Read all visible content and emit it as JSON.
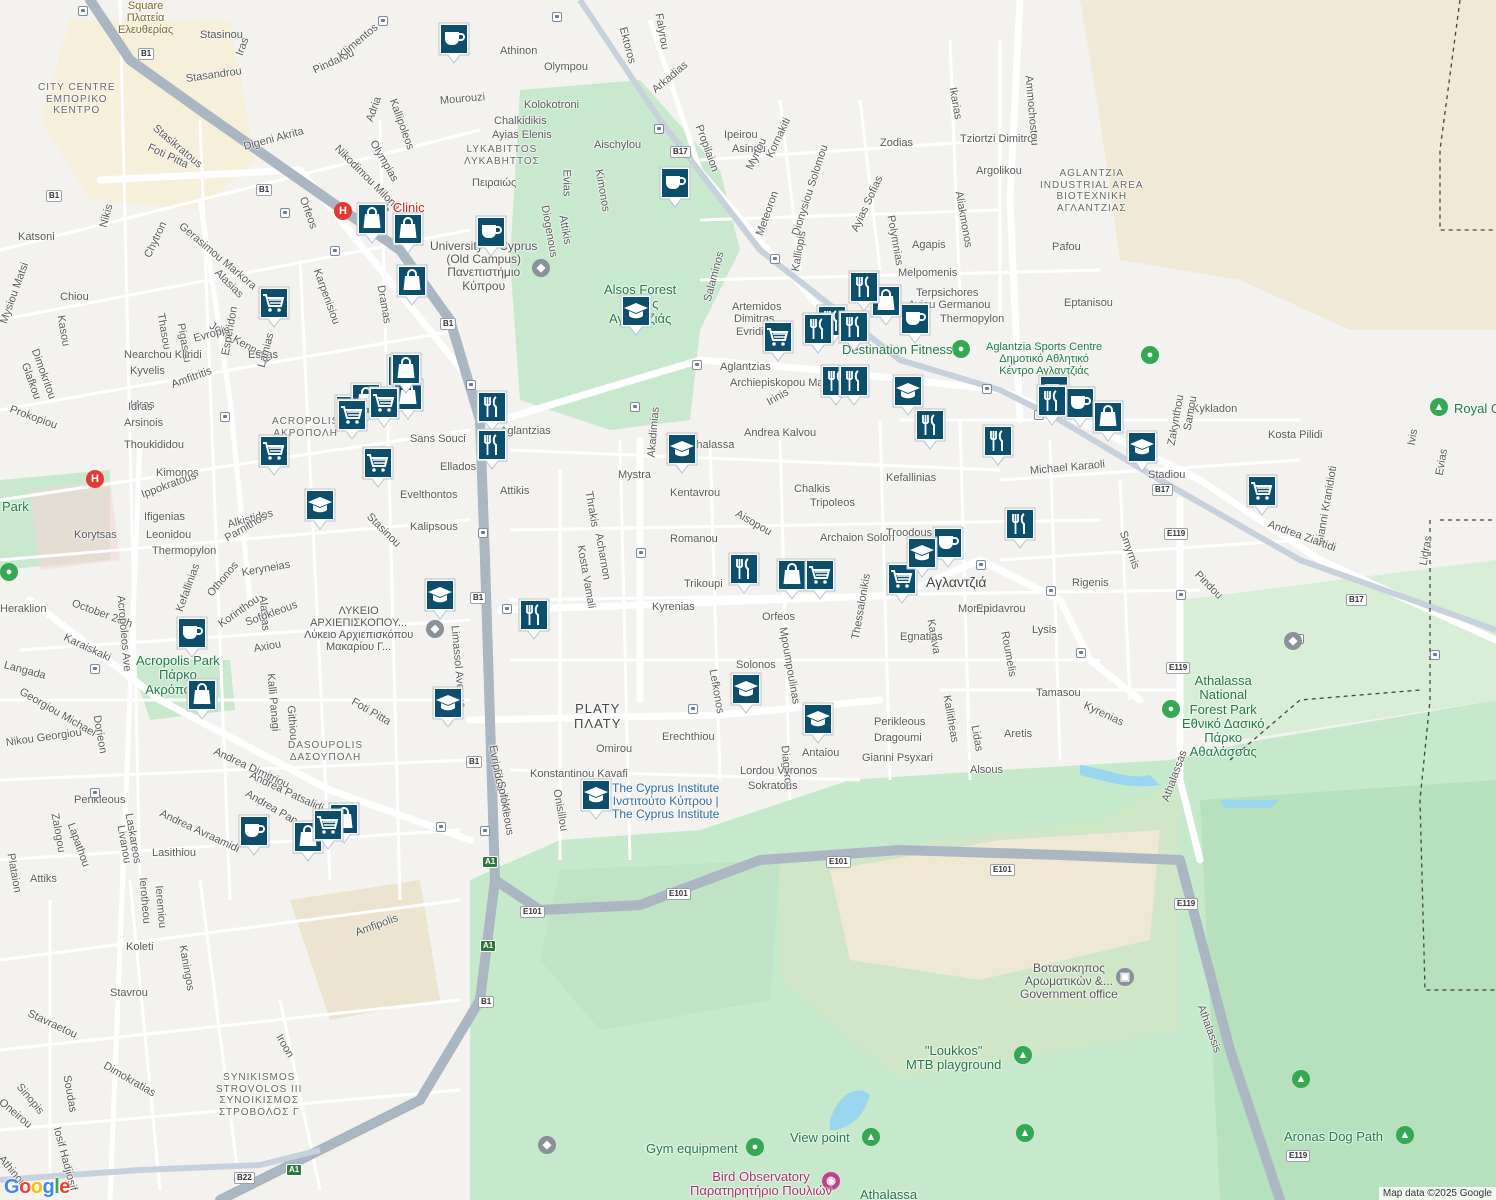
{
  "map": {
    "attribution": "Map data ©2025 Google",
    "logo_text": "Google",
    "colors": {
      "background": "#f3f2ef",
      "park": "#c9e9cf",
      "forest": "#bfe3c4",
      "road": "#ffffff",
      "highway": "#b8c3cf",
      "water": "#9ad6f0",
      "pin": "#0b4f6c",
      "boundary": "#444444"
    }
  },
  "street_labels": [
    "Stasinou",
    "Pindarou",
    "Stasandrou",
    "Iras",
    "Klimentos",
    "Kallipoleos",
    "Athinon",
    "Olympou",
    "Ektoros",
    "Falyrou",
    "Mourouzi",
    "Arkadias",
    "Kolokotroni",
    "Chalkidikis",
    "Ayias Elenis",
    "Aischylou",
    "Ipeirou",
    "Asinou",
    "Propilaion",
    "Stasikratous",
    "Foti Pitta",
    "Digeni Akrita",
    "Olympias",
    "Nikodimou Milona",
    "Adria",
    "Zodias",
    "Tziortzi Dimitrof",
    "Argolikou",
    "Myrtou",
    "Kornakiti",
    "Ikarias",
    "Ammochostou",
    "Evias",
    "Kimonos",
    "Πειραιώς",
    "Diogenous",
    "Attikis",
    "Meteoron",
    "Dionysiou Solomou",
    "Ayias Sofias",
    "Polymnias",
    "Agapis",
    "Aliakmonos",
    "Pafou",
    "Gerasimou Markora",
    "Orfeos",
    "Katsoni",
    "Nikis",
    "Chytron",
    "Alasias",
    "Karpenisiou",
    "Dramas",
    "Chiou",
    "Thasou",
    "Pigasou",
    "John Kennedy",
    "Estias",
    "Esperidon",
    "Nearchou Kliridi",
    "Kyvelis",
    "Amfitritis",
    "Lamias",
    "Evropis",
    "Kalliopis",
    "Artemidos",
    "Dimitras",
    "Evridikis",
    "Melpomenis",
    "Terpsichores",
    "Ayiou Germanou",
    "Thermopylon",
    "Eptanisou",
    "Salaminos",
    "Aglantzias",
    "Archiepiskopou Makariou III",
    "Irinis",
    "Andrea Kalvou",
    "Idras",
    "Arsinois",
    "Thoukididou",
    "Kimonos",
    "Ippokratous",
    "Ifigenias",
    "Sans Souci",
    "Ellados",
    "Attikis",
    "Mystra",
    "Akadimias",
    "Kentavrou",
    "Chalkis",
    "Tripoleos",
    "Kefallinias",
    "Michael Karaoli",
    "Stadiou",
    "Kykladon",
    "Kosta Pilidi",
    "Evelthontos",
    "Thrakis",
    "Acharnon",
    "Kosta Vamali",
    "Aisopou",
    "Romanou",
    "Archaion Solon",
    "Troodous",
    "Kalipsous",
    "Alkistidos",
    "Parnithos",
    "Leonidou",
    "Thermopylon",
    "Korytsas",
    "Evripidou",
    "Stasinou",
    "Smyrnis",
    "Pindou",
    "Gianni Kranidioti",
    "Lidras",
    "Andrea Ziartidi",
    "Zakynthou",
    "Samou",
    "Ivis",
    "Trikoupi",
    "Kyrenias",
    "Orfeos",
    "Mpoumpoulinas",
    "Karava",
    "Morfou",
    "Epidavrou",
    "Roumelis",
    "Rigenis",
    "Lysis",
    "Egnatias",
    "Heraklion",
    "October 28th",
    "Kefallinias",
    "Othonos",
    "Korinthou",
    "Keryneias",
    "Alasias",
    "Karaiskaki",
    "Sofokleous",
    "Axiou",
    "Kalli Panagi",
    "Githiou",
    "Foti Pitta",
    "Langada",
    "Georgiou Michael",
    "Nikou Georgiou",
    "Thessalonikis",
    "Solonos",
    "Lefkonos",
    "Kallitheas",
    "Lidas",
    "Aretis",
    "Tamasou",
    "Kyrenias",
    "Perikleous",
    "Dragoumi",
    "Gianni Psyxari",
    "Alsous",
    "Erechthiou",
    "Diagorou",
    "Antaiou",
    "Lordou Vyronos",
    "Sokratous",
    "Omirou",
    "Konstantinou Kavafi",
    "Onisillou",
    "Andrea Dimitriou",
    "Andrea Patsalidi",
    "Andrea Panagidi",
    "Andrea Avraamidi",
    "Perikleous",
    "Zalogou",
    "Lapathou",
    "Lasithiou",
    "Livanou",
    "Laskareos",
    "Plataion",
    "Attiks",
    "Koleti",
    "Ierotheou",
    "Ieremiou",
    "Kaningos",
    "Amfipolis",
    "Stavrou",
    "Stavraetou",
    "Iroon",
    "Dimokratias",
    "Sinopis",
    "Soudas",
    "Oneirou",
    "Iosif Hadjiosif",
    "Athinou",
    "Athalassas",
    "Athalassis",
    "Acropoleos Ave",
    "Dorieon",
    "Limassol Avenue",
    "Evripidou",
    "Sofokleous",
    "Prokopiou",
    "Glafkou",
    "Dimokritou",
    "Kasou",
    "Evias",
    "Aglantzias",
    "Athalassa",
    "Mysiou Matsi",
    "Idras"
  ],
  "area_labels": [
    "CITY CENTRE\nΕΜΠΟΡΙΚΟ\nΚΕΝΤΡΟ",
    "LYKABITTOS\nΛΥΚΑΒΗΤΤΟΣ",
    "AGLANTZIA\nINDUSTRIAL AREA\nΒΙΟΤΕΧΝΙΚΗ\nΑΓΛΑΝΤΖΙΑΣ",
    "ACROPOLIS\nΑΚΡΟΠΟΛΗ",
    "PLATY\nΠΛΑΤΥ",
    "DASOUPOLIS\nΔΑΣΟΥΠΟΛΗ",
    "SYNIKISMOS\nSTROVOLOS III\nΣΥΝΟΙΚΙΣΜΟΣ\nΣΤΡΟΒΟΛΟΣ Γ",
    "Αγλαντζιά"
  ],
  "poi_labels": {
    "clinic": "IASIS Clinic",
    "university": "University of Cyprus\n(Old Campus)\nΠανεπιστήμιο\nΚύπρου",
    "alsos_forest": "Alsos Forest\nΆλσος\nΑγλαντζιάς",
    "destination_fitness": "Destination Fitness",
    "sports_centre": "Aglantzia Sports Centre\nΔημοτικό Αθλητικό\nΚέντρο Αγλαντζιάς",
    "royal": "Royal G",
    "lykeio": "ΛΥΚΕΙΟ\nΑΡΧΙΕΠΙΣΚΟΠΟΥ...\nΛύκειο Αρχιεπισκόπου\nΜακαρίου Γ...",
    "acropolis_park": "Acropolis Park\nΠάρκο\nΑκρόπολης",
    "cyprus_institute": "The Cyprus Institute\nΙνστιτούτο Κύπρου |\nThe Cyprus Institute",
    "athalassa_park": "Athalassa\nNational\nForest Park\nΕθνικό Δασικό\nΠάρκο\nΑθαλάσσας",
    "botanical": "Βοτανοκηπος\nΑρωματικών &...\nGovernment office",
    "loukkos": "\"Loukkos\"\nMTB playground",
    "view_point": "View point",
    "gym_equipment": "Gym equipment",
    "bird_observatory": "Bird Observatory\nΠαρατηρητήριο Πουλιών",
    "aronas": "Aronas Dog Path",
    "athalassa": "Athalassa",
    "park_left": "Park",
    "square": "Square\nΠλατεία\nΕλευθερίας"
  },
  "road_shields": [
    "B1",
    "B1",
    "B1",
    "B1",
    "B1",
    "B1",
    "B1",
    "B17",
    "B17",
    "B17",
    "E119",
    "E119",
    "E119",
    "E119",
    "E101",
    "E101",
    "E101",
    "E101",
    "A1",
    "A1",
    "A1",
    "B22"
  ],
  "marker_types": {
    "coffee": "coffee-cup-icon",
    "shopping": "shopping-bag-icon",
    "grocery": "shopping-cart-icon",
    "restaurant": "fork-knife-icon",
    "school": "graduation-cap-icon"
  },
  "marker_counts": {
    "coffee": 10,
    "shopping": 13,
    "grocery": 10,
    "restaurant": 15,
    "school": 11
  }
}
